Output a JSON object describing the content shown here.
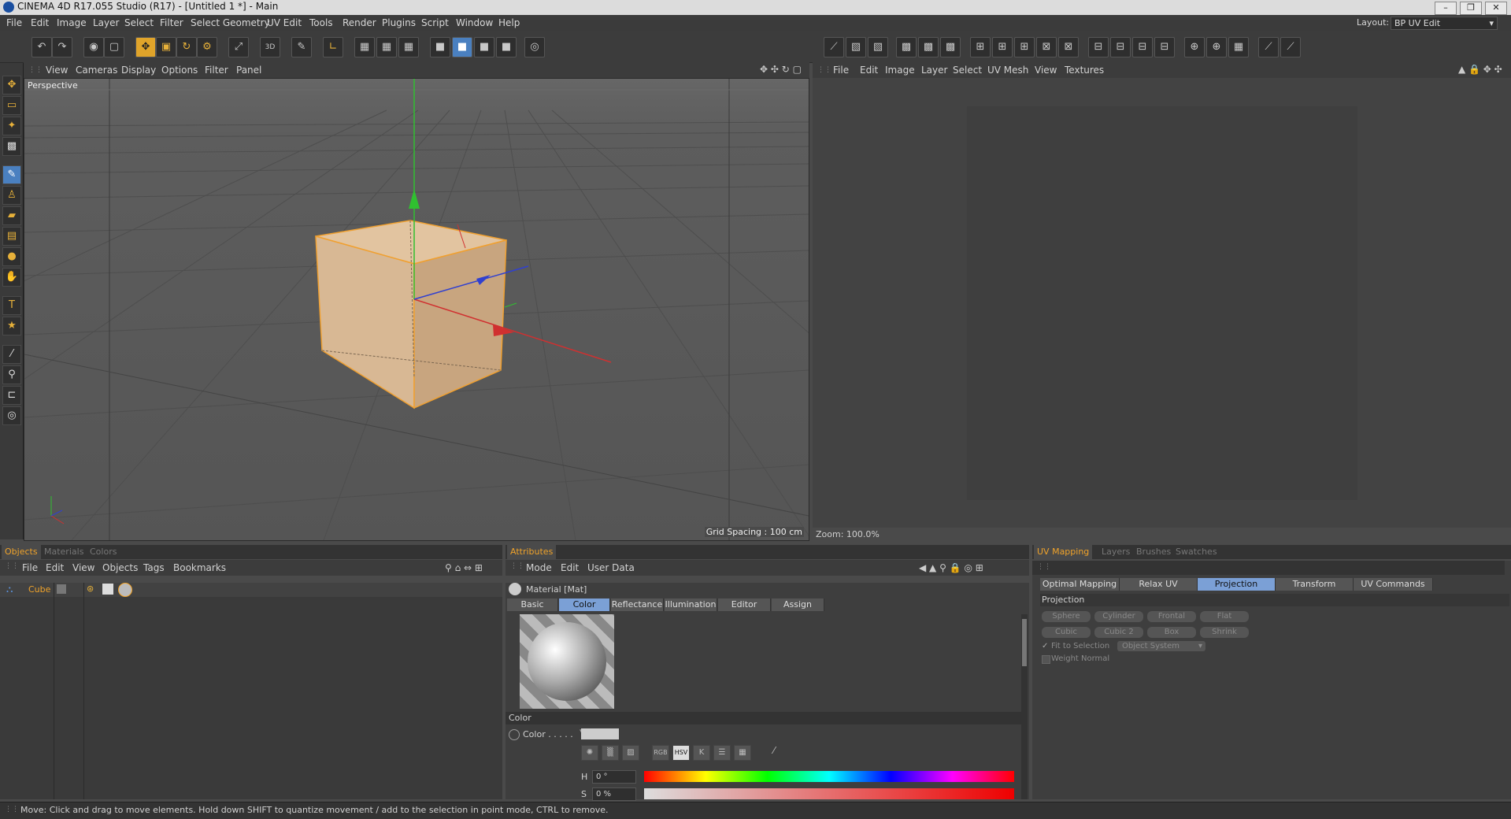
{
  "window": {
    "title": "CINEMA 4D R17.055 Studio (R17) - [Untitled 1 *] - Main",
    "layout_label": "Layout:",
    "layout_value": "BP UV Edit"
  },
  "menubar": [
    "File",
    "Edit",
    "Image",
    "Layer",
    "Select",
    "Filter",
    "Select Geometry",
    "UV Edit",
    "Tools",
    "Render",
    "Plugins",
    "Script",
    "Window",
    "Help"
  ],
  "viewport": {
    "menu": [
      "View",
      "Cameras",
      "Display",
      "Options",
      "Filter",
      "Panel"
    ],
    "label": "Perspective",
    "grid_spacing": "Grid Spacing : 100 cm"
  },
  "uv_editor": {
    "menu": [
      "File",
      "Edit",
      "Image",
      "Layer",
      "Select",
      "UV Mesh",
      "View",
      "Textures"
    ],
    "zoom": "Zoom: 100.0%"
  },
  "objects_panel": {
    "tabs": [
      "Objects",
      "Materials",
      "Colors"
    ],
    "menu": [
      "File",
      "Edit",
      "View",
      "Objects",
      "Tags",
      "Bookmarks"
    ],
    "object_name": "Cube"
  },
  "attributes_panel": {
    "tab": "Attributes",
    "menu": [
      "Mode",
      "Edit",
      "User Data"
    ],
    "material_label": "Material [Mat]",
    "tabs": [
      "Basic",
      "Color",
      "Reflectance",
      "Illumination",
      "Editor",
      "Assign"
    ],
    "section_title": "Color",
    "color_label": "Color . . . . .",
    "h_label": "H",
    "h_value": "0 °",
    "s_label": "S",
    "s_value": "0 %"
  },
  "uv_panel": {
    "tabs": [
      "UV Mapping",
      "Layers",
      "Brushes",
      "Swatches"
    ],
    "subtabs": [
      "Optimal Mapping",
      "Relax UV",
      "Projection",
      "Transform",
      "UV Commands"
    ],
    "section_title": "Projection",
    "buttons": [
      "Sphere",
      "Cylinder",
      "Frontal",
      "Flat",
      "Cubic",
      "Cubic 2",
      "Box",
      "Shrink"
    ],
    "fit_to_selection": "Fit to Selection",
    "object_system": "Object System",
    "weight_normal": "Weight Normal"
  },
  "status": "Move: Click and drag to move elements. Hold down SHIFT to quantize movement / add to the selection in point mode, CTRL to remove."
}
